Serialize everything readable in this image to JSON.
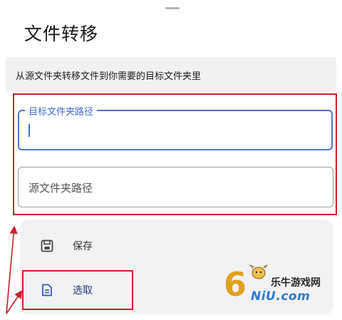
{
  "sheet": {
    "title": "文件转移",
    "description": "从源文件夹转移文件到你需要的目标文件夹里"
  },
  "fields": {
    "target_label": "目标文件夹路径",
    "target_value": "",
    "source_placeholder": "源文件夹路径"
  },
  "menu": {
    "items": [
      {
        "label": "保存",
        "icon": "save-icon"
      },
      {
        "label": "选取",
        "icon": "document-icon"
      }
    ]
  },
  "colors": {
    "focus_blue": "#4d75c7",
    "annotation_red": "#d01b2a"
  },
  "watermark": {
    "digit": "6",
    "brand_cn": "乐牛游戏网",
    "brand_en": "NiU.com"
  }
}
